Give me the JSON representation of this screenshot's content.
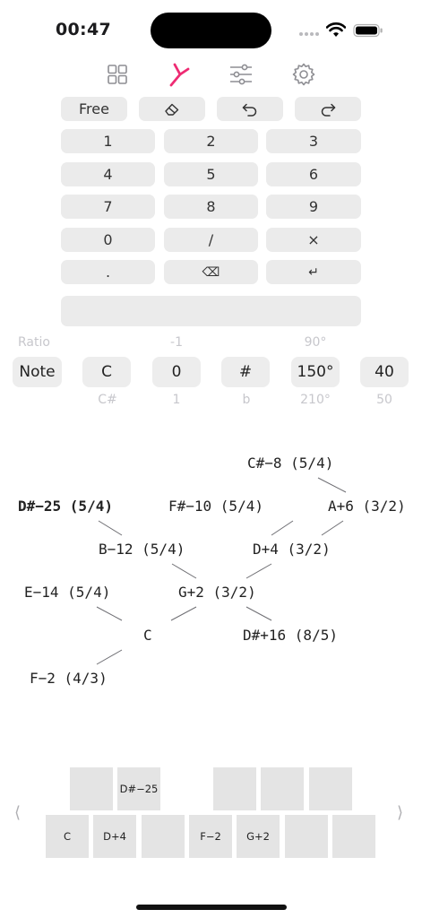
{
  "status_bar": {
    "time": "00:47"
  },
  "toolbar": {
    "accent": "#ee2b73",
    "icons": [
      "grid-icon",
      "tuning-fork-icon",
      "sliders-icon",
      "gear-icon"
    ],
    "active": "tuning-fork-icon"
  },
  "action_row": {
    "free_label": "Free"
  },
  "keypad": {
    "rows": [
      [
        "1",
        "2",
        "3"
      ],
      [
        "4",
        "5",
        "6"
      ],
      [
        "7",
        "8",
        "9"
      ],
      [
        "0",
        "/",
        "×"
      ],
      [
        ".",
        "⌫",
        "↵"
      ]
    ]
  },
  "picker": {
    "above": [
      "Ratio",
      "-1",
      "90°"
    ],
    "selected": [
      "Note",
      "C",
      "0",
      "#",
      "150°",
      "40"
    ],
    "below": [
      "C#",
      "1",
      "b",
      "210°",
      "50"
    ]
  },
  "lattice": {
    "nodes": [
      "C#−8 (5/4)",
      "D#−25 (5/4)",
      "F#−10 (5/4)",
      "A+6 (3/2)",
      "B−12 (5/4)",
      "D+4 (3/2)",
      "E−14 (5/4)",
      "G+2 (3/2)",
      "C",
      "D#+16 (8/5)",
      "F−2 (4/3)"
    ]
  },
  "keyboard": {
    "upper_keys": [
      "",
      "D#−25",
      "",
      "",
      ""
    ],
    "lower_keys": [
      "C",
      "D+4",
      "",
      "F−2",
      "G+2",
      "",
      ""
    ],
    "prev_label": "⟨",
    "next_label": "⟩"
  }
}
